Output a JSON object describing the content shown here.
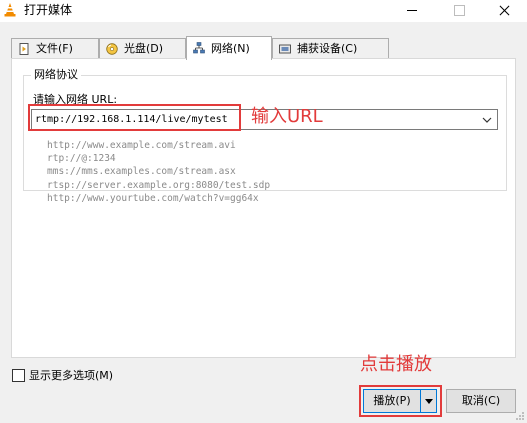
{
  "window": {
    "title": "打开媒体",
    "icon": "vlc-cone-icon",
    "controls": [
      "minimize",
      "maximize",
      "close"
    ]
  },
  "tabs": [
    {
      "label": "文件(F)",
      "icon": "file-icon",
      "active": false
    },
    {
      "label": "光盘(D)",
      "icon": "disc-icon",
      "active": false
    },
    {
      "label": "网络(N)",
      "icon": "network-icon",
      "active": true
    },
    {
      "label": "捕获设备(C)",
      "icon": "capture-device-icon",
      "active": false
    }
  ],
  "network": {
    "group_title": "网络协议",
    "url_label": "请输入网络 URL:",
    "url_value": "rtmp://192.168.1.114/live/mytest",
    "examples": [
      "http://www.example.com/stream.avi",
      "rtp://@:1234",
      "mms://mms.examples.com/stream.asx",
      "rtsp://server.example.org:8080/test.sdp",
      "http://www.yourtube.com/watch?v=gg64x"
    ]
  },
  "footer": {
    "more_options_label": "显示更多选项(M)",
    "more_options_checked": false,
    "play_label": "播放(P)",
    "cancel_label": "取消(C)"
  },
  "annotations": {
    "url_note": "输入URL",
    "play_note": "点击播放",
    "color": "#e23b3b"
  }
}
